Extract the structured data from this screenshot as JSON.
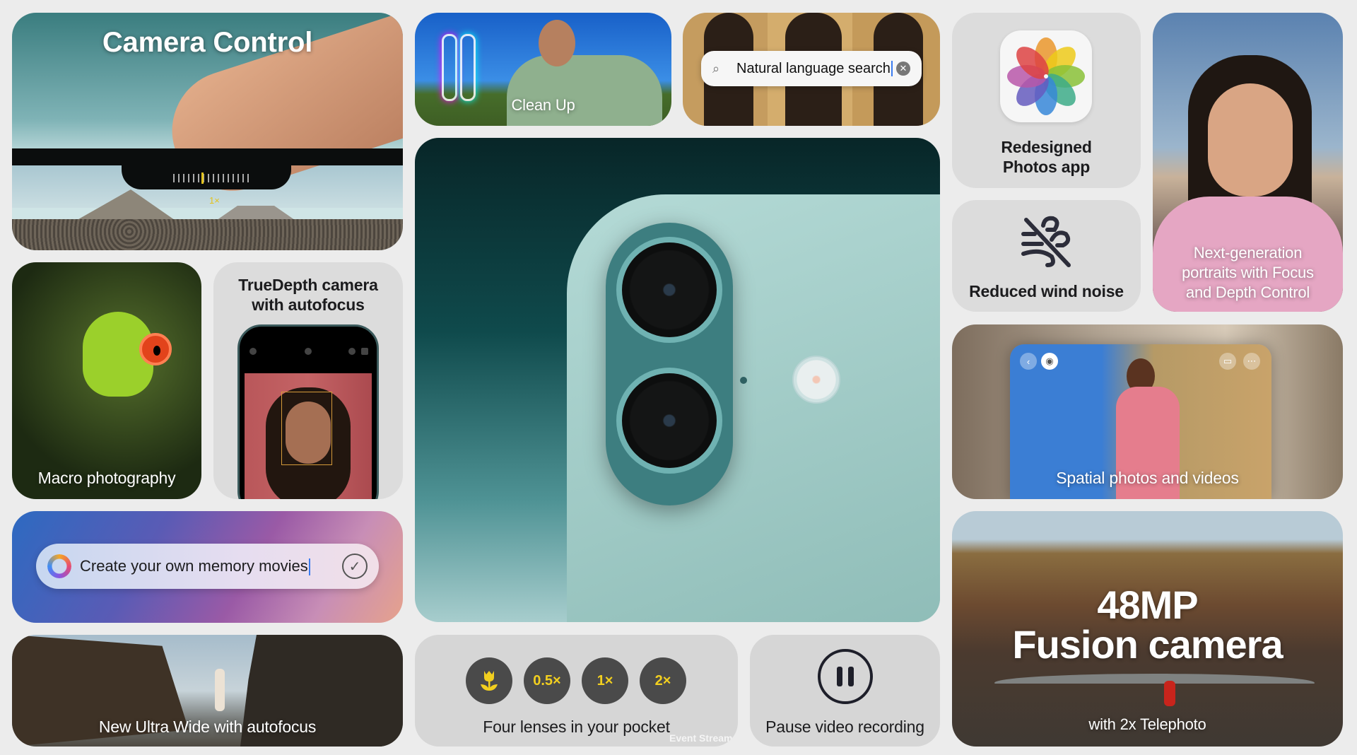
{
  "tiles": {
    "camera_control": {
      "title": "Camera Control",
      "zoom_level": "1×"
    },
    "clean_up": {
      "caption": "Clean Up"
    },
    "natural_search": {
      "query": "Natural language search",
      "search_icon": "magnifying-glass",
      "clear_icon": "x-circle"
    },
    "photos_app": {
      "caption_line1": "Redesigned",
      "caption_line2": "Photos app",
      "icon": "photos-flower"
    },
    "wind_noise": {
      "caption": "Reduced wind noise",
      "icon": "wind-slash"
    },
    "portraits": {
      "line1": "Next-generation",
      "line2": "portraits with Focus",
      "line3": "and Depth Control"
    },
    "macro": {
      "caption": "Macro photography"
    },
    "truedepth": {
      "line1": "TrueDepth camera",
      "line2": "with autofocus"
    },
    "memory": {
      "prompt": "Create your own memory movies",
      "left_icon": "apple-intelligence",
      "confirm_icon": "checkmark-circle"
    },
    "ultra_wide": {
      "caption": "New Ultra Wide with autofocus"
    },
    "lenses": {
      "caption": "Four lenses in your pocket",
      "buttons": [
        "macro",
        "0.5×",
        "1×",
        "2×"
      ],
      "macro_icon": "tulip",
      "accent_color": "#f2cf1f"
    },
    "pause": {
      "caption": "Pause video recording",
      "icon": "pause-circle"
    },
    "spatial": {
      "caption": "Spatial photos and videos"
    },
    "fusion": {
      "line1": "48MP",
      "line2": "Fusion camera",
      "subtitle": "with 2x Telephoto"
    }
  },
  "overlay": {
    "stream_label": "Event Stream"
  }
}
